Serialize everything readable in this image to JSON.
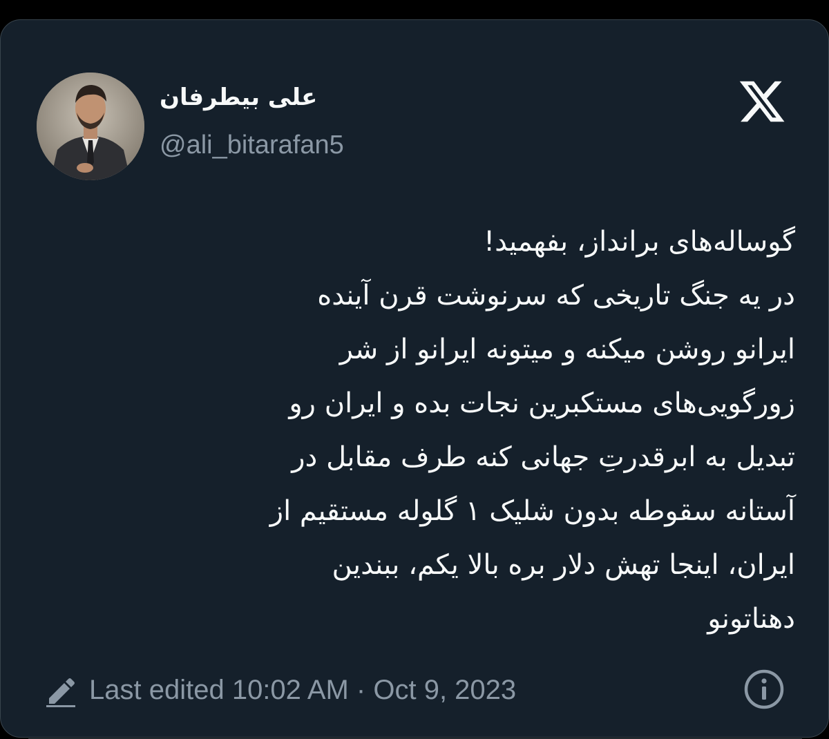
{
  "author": {
    "display_name": "علی بیطرفان",
    "handle": "@ali_bitarafan5",
    "avatar_icon": "profile-photo"
  },
  "platform": {
    "logo_icon": "x-logo"
  },
  "tweet": {
    "lines": [
      "گوساله‌های برانداز، بفهمید!",
      "در یه جنگ تاریخی که سرنوشت قرن آینده",
      "ایرانو روشن میکنه و میتونه ایرانو از شر",
      "زورگویی‌های مستکبرین نجات بده و ایران رو",
      "تبدیل به ابرقدرتِ جهانی کنه طرف مقابل در",
      "آستانه سقوطه بدون شلیک ۱ گلوله مستقیم از",
      "ایران، اینجا تهش دلار بره بالا یکم، ببندین",
      "دهناتونو"
    ]
  },
  "meta": {
    "edit_icon": "pencil-icon",
    "edited_label": "Last edited 10:02 AM · Oct 9, 2023",
    "info_icon": "info-icon"
  },
  "colors": {
    "background": "#15202b",
    "text": "#f7f9f9",
    "secondary": "#8b98a5",
    "border": "#38444d"
  }
}
